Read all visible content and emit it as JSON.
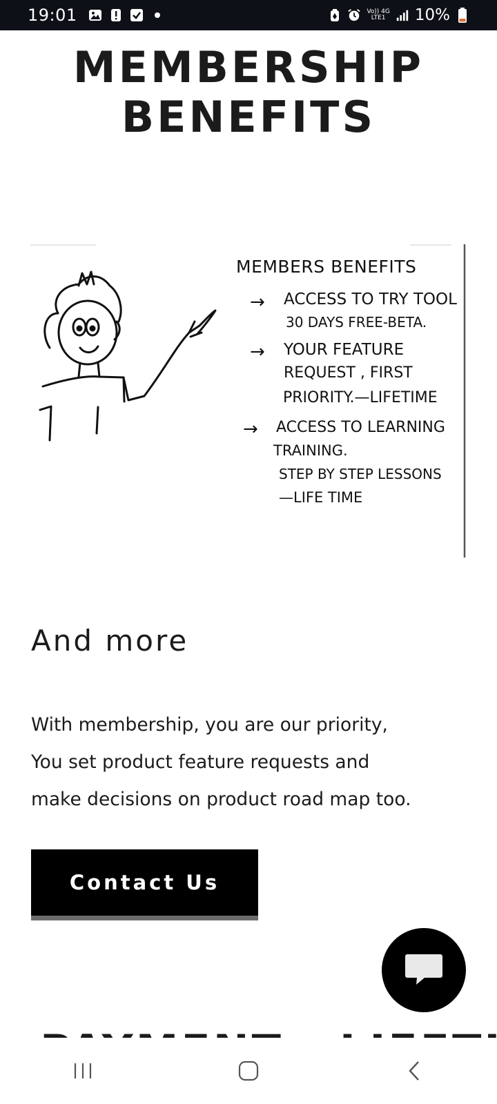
{
  "status_bar": {
    "time": "19:01",
    "battery": "10%",
    "network": {
      "top": "Vo)) 4G",
      "bottom": "LTE1"
    },
    "left_icons": [
      "gallery-icon",
      "alert-icon",
      "checkbox-icon",
      "dot-icon"
    ],
    "right_icons": [
      "battery-saver-icon",
      "alarm-icon",
      "network-icon",
      "signal-icon",
      "battery-icon"
    ],
    "battery_color": "#e0703a"
  },
  "page": {
    "title_line1": "MEMBERSHIP",
    "title_line2": "BENEFITS"
  },
  "illustration": {
    "heading": "MEMBERS  BENEFITS",
    "lines": [
      "ACCESS TO TRY TOOL",
      "30 DAYS  FREE-BETA.",
      "YOUR  FEATURE",
      "REQUEST ,  FIRST",
      "PRIORITY.—LIFETIME",
      "ACCESS  TO  LEARNING",
      "TRAINING.",
      "STEP  BY STEP  LESSONS",
      "—LIFE  TIME"
    ]
  },
  "more_section": {
    "heading": "And more",
    "body_lines": [
      "With membership, you are our priority,",
      "You set product feature requests and",
      "make decisions on product road map too."
    ]
  },
  "contact_button": {
    "label": "Contact Us"
  },
  "chat_fab": {
    "icon": "chat-icon"
  },
  "next_section": {
    "heading": "PAYMENT - LIFETIME"
  },
  "nav_bar": {
    "icons": [
      "recent-apps-icon",
      "home-icon",
      "back-icon"
    ]
  }
}
